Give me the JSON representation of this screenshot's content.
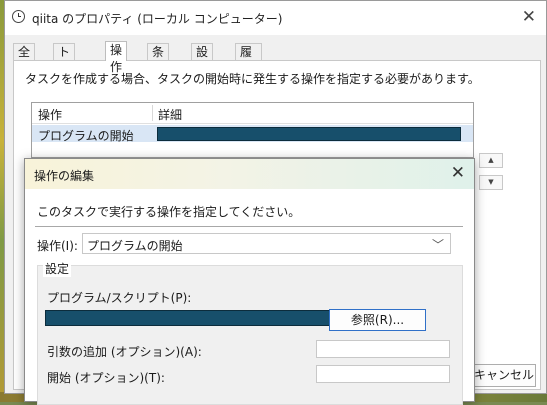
{
  "window": {
    "title": "qiita のプロパティ (ローカル コンピューター)",
    "tabs": [
      "全般",
      "トリガー",
      "操作",
      "条件",
      "設定",
      "履歴 (無効)"
    ],
    "active_tab": "操作",
    "description": "タスクを作成する場合、タスクの開始時に発生する操作を指定する必要があります。",
    "columns": [
      "操作",
      "詳細"
    ],
    "rows": [
      {
        "action": "プログラムの開始"
      }
    ],
    "cancel_label": "キャンセル"
  },
  "dialog": {
    "title": "操作の編集",
    "prompt": "このタスクで実行する操作を指定してください。",
    "action_label": "操作(I):",
    "action_value": "プログラムの開始",
    "settings_label": "設定",
    "program_label": "プログラム/スクリプト(P):",
    "browse_label": "参照(R)...",
    "args_label": "引数の追加 (オプション)(A):",
    "start_label": "開始 (オプション)(T):"
  },
  "colors": {
    "redaction": "#174f6b",
    "selection": "#d9e6f5",
    "accent_border": "#3070c8"
  }
}
